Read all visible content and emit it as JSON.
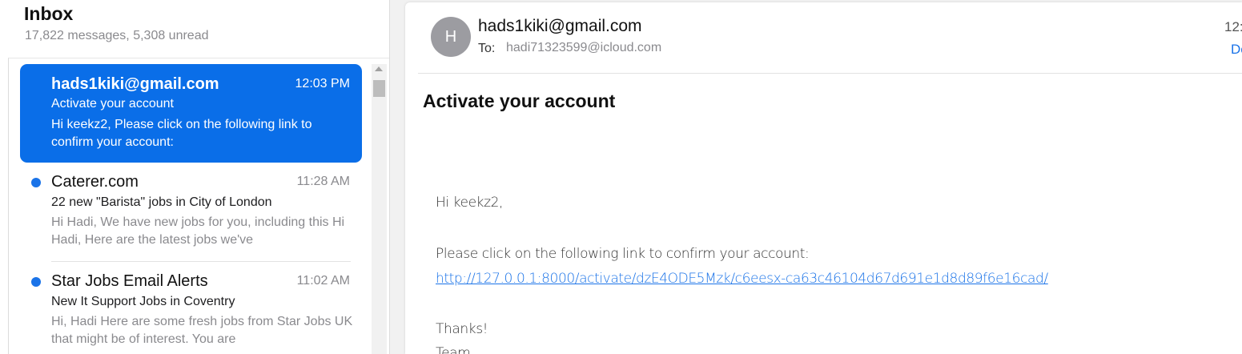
{
  "inbox": {
    "title": "Inbox",
    "count_text": "17,822 messages, 5,308 unread",
    "messages": [
      {
        "sender": "hads1kiki@gmail.com",
        "time": "12:03 PM",
        "subject": "Activate your account",
        "preview": "Hi keekz2, Please click on the following link to confirm your account:",
        "selected": true,
        "unread": false
      },
      {
        "sender": "Caterer.com",
        "time": "11:28 AM",
        "subject": "22 new \"Barista\" jobs in City of London",
        "preview": "Hi Hadi, We have new jobs for you, including this Hi Hadi, Here are the latest jobs we've",
        "selected": false,
        "unread": true
      },
      {
        "sender": "Star Jobs Email Alerts",
        "time": "11:02 AM",
        "subject": "New It Support Jobs in Coventry",
        "preview": "Hi, Hadi Here are some fresh jobs from Star Jobs UK that might be of interest. You are",
        "selected": false,
        "unread": true
      }
    ]
  },
  "reader": {
    "avatar_initial": "H",
    "from": "hads1kiki@gmail.com",
    "to_label": "To:",
    "to_address": "hadi71323599@icloud.com",
    "time_partial": "12:",
    "details_partial": "De",
    "subject": "Activate your account",
    "body": {
      "greeting": "Hi keekz2,",
      "line1": "Please click on the following link to confirm your account:",
      "link": "http://127.0.0.1:8000/activate/dzE4ODE5Mzk/c6eesx-ca63c46104d67d691e1d8d89f6e16cad/",
      "thanks": "Thanks!",
      "signature_partial": "Team"
    }
  },
  "colors": {
    "accent": "#0a6ee8",
    "unread_dot": "#1a73e8",
    "link": "#1a73e8"
  }
}
